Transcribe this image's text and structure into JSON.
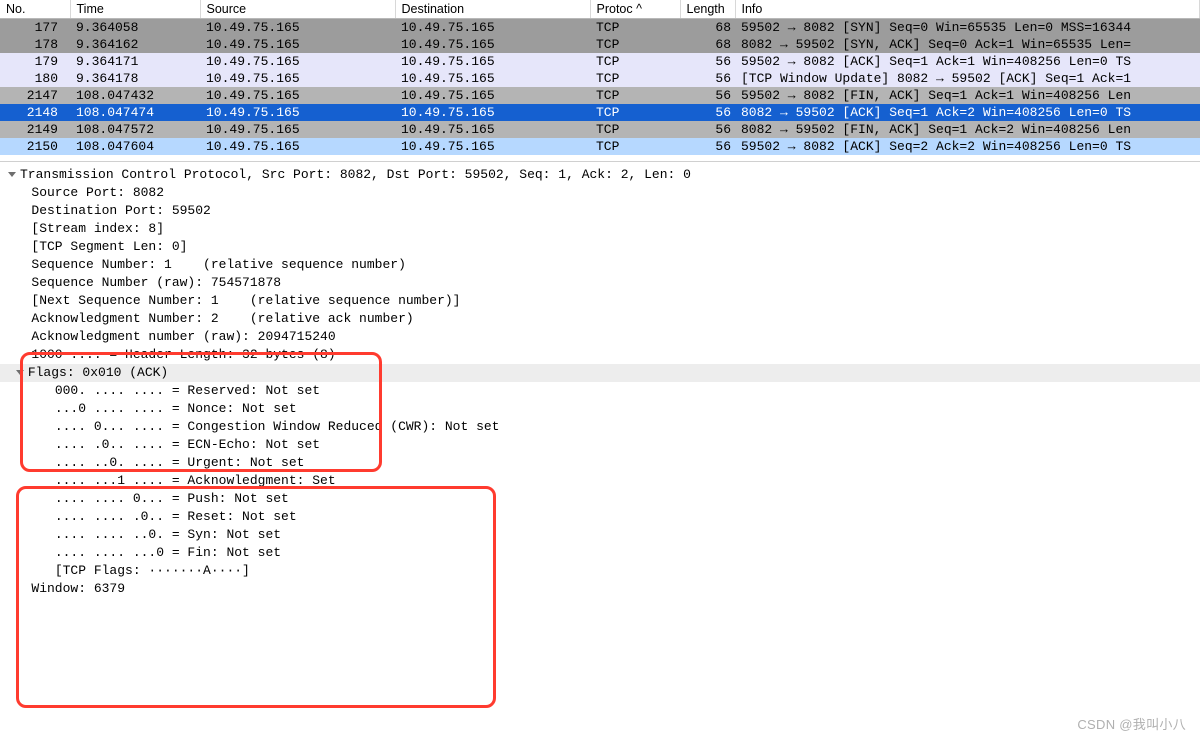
{
  "columns": {
    "no": "No.",
    "time": "Time",
    "source": "Source",
    "destination": "Destination",
    "protocol": "Protoc ^",
    "length": "Length",
    "info": "Info"
  },
  "packets": [
    {
      "no": "177",
      "time": "9.364058",
      "src": "10.49.75.165",
      "dst": "10.49.75.165",
      "proto": "TCP",
      "len": "68",
      "info": "59502 → 8082  [SYN]  Seq=0 Win=65535 Len=0 MSS=16344",
      "cls": "row-greydark"
    },
    {
      "no": "178",
      "time": "9.364162",
      "src": "10.49.75.165",
      "dst": "10.49.75.165",
      "proto": "TCP",
      "len": "68",
      "info": "8082 → 59502  [SYN, ACK]  Seq=0 Ack=1 Win=65535 Len=",
      "cls": "row-greydark"
    },
    {
      "no": "179",
      "time": "9.364171",
      "src": "10.49.75.165",
      "dst": "10.49.75.165",
      "proto": "TCP",
      "len": "56",
      "info": "59502 → 8082  [ACK]  Seq=1 Ack=1 Win=408256 Len=0 TS",
      "cls": "row-lavender"
    },
    {
      "no": "180",
      "time": "9.364178",
      "src": "10.49.75.165",
      "dst": "10.49.75.165",
      "proto": "TCP",
      "len": "56",
      "info": " [TCP Window Update]  8082 → 59502  [ACK]  Seq=1 Ack=1",
      "cls": "row-lavender"
    },
    {
      "no": "2147",
      "time": "108.047432",
      "src": "10.49.75.165",
      "dst": "10.49.75.165",
      "proto": "TCP",
      "len": "56",
      "info": "59502 → 8082  [FIN, ACK]  Seq=1 Ack=1 Win=408256 Len",
      "cls": "row-greymid"
    },
    {
      "no": "2148",
      "time": "108.047474",
      "src": "10.49.75.165",
      "dst": "10.49.75.165",
      "proto": "TCP",
      "len": "56",
      "info": "8082 → 59502  [ACK]  Seq=1 Ack=2 Win=408256 Len=0 TS",
      "cls": "row-selected"
    },
    {
      "no": "2149",
      "time": "108.047572",
      "src": "10.49.75.165",
      "dst": "10.49.75.165",
      "proto": "TCP",
      "len": "56",
      "info": "8082 → 59502  [FIN, ACK]  Seq=1 Ack=2 Win=408256 Len",
      "cls": "row-greymid"
    },
    {
      "no": "2150",
      "time": "108.047604",
      "src": "10.49.75.165",
      "dst": "10.49.75.165",
      "proto": "TCP",
      "len": "56",
      "info": "59502 → 8082  [ACK]  Seq=2 Ack=2 Win=408256 Len=0 TS",
      "cls": "row-lightblue"
    }
  ],
  "detail": {
    "header": "Transmission Control Protocol, Src Port: 8082, Dst Port: 59502, Seq: 1, Ack: 2, Len: 0",
    "srcport": "Source Port: 8082",
    "dstport": "Destination Port: 59502",
    "stream": "[Stream index: 8]",
    "seglen": "[TCP Segment Len: 0]",
    "seqrel": "Sequence Number: 1    (relative sequence number)",
    "seqraw": "Sequence Number (raw): 754571878",
    "nextseq": "[Next Sequence Number: 1    (relative sequence number)]",
    "ackrel": "Acknowledgment Number: 2    (relative ack number)",
    "ackraw": "Acknowledgment number (raw): 2094715240",
    "hdrlen": "1000 .... = Header Length: 32 bytes (8)",
    "flagshead": "Flags: 0x010 (ACK)",
    "flag_res": "000. .... .... = Reserved: Not set",
    "flag_non": "...0 .... .... = Nonce: Not set",
    "flag_cwr": ".... 0... .... = Congestion Window Reduced (CWR): Not set",
    "flag_ecn": ".... .0.. .... = ECN-Echo: Not set",
    "flag_urg": ".... ..0. .... = Urgent: Not set",
    "flag_ack": ".... ...1 .... = Acknowledgment: Set",
    "flag_psh": ".... .... 0... = Push: Not set",
    "flag_rst": ".... .... .0.. = Reset: Not set",
    "flag_syn": ".... .... ..0. = Syn: Not set",
    "flag_fin": ".... .... ...0 = Fin: Not set",
    "tcpflags": "[TCP Flags: ·······A····]",
    "window": "Window: 6379"
  },
  "watermark": "CSDN @我叫小八"
}
